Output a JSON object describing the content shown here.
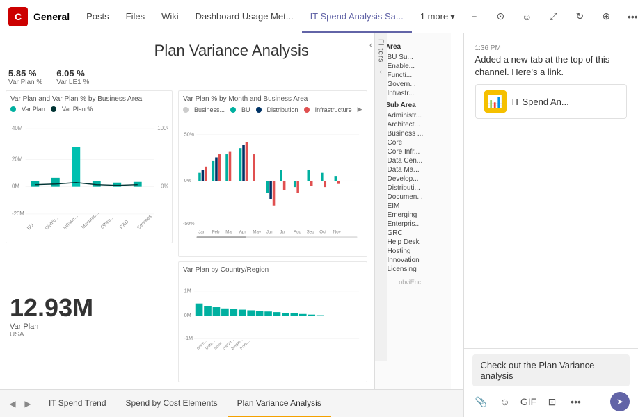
{
  "topnav": {
    "app_icon": "C",
    "channel": "General",
    "tabs": [
      {
        "label": "Posts",
        "active": false
      },
      {
        "label": "Files",
        "active": false
      },
      {
        "label": "Wiki",
        "active": false
      },
      {
        "label": "Dashboard Usage Met...",
        "active": false
      },
      {
        "label": "IT Spend Analysis Sa...",
        "active": true
      },
      {
        "label": "1 more",
        "active": false
      }
    ],
    "add_label": "+",
    "meet_label": "Meet"
  },
  "report": {
    "title": "Plan Variance Analysis",
    "stats": [
      {
        "value": "5.85 %",
        "label": "Var Plan %"
      },
      {
        "value": "6.05 %",
        "label": "Var LE1 %"
      }
    ],
    "line_chart_label": "Var Plan and Var Plan % by Business Area",
    "legend": [
      {
        "label": "Var Plan",
        "color": "#00b0a0"
      },
      {
        "label": "Var Plan %",
        "color": "#003333"
      }
    ],
    "bar_chart_label": "Var Plan % by Month and Business Area",
    "bar_legend": [
      {
        "label": "Business...",
        "color": "#ccc"
      },
      {
        "label": "BU",
        "color": "#00b0a0"
      },
      {
        "label": "Distribution",
        "color": "#003366"
      },
      {
        "label": "Infrastructure",
        "color": "#e05050"
      }
    ],
    "country_chart_label": "Var Plan by Country/Region",
    "big_number": "12.93M",
    "big_label": "Var Plan",
    "big_sublabel": "USA",
    "filters_label": "Filters",
    "it_area_title": "IT Area",
    "it_area_items": [
      "BU Su...",
      "Enable...",
      "Functi...",
      "Govern...",
      "Infrastr..."
    ],
    "it_sub_area_title": "IT Sub Area",
    "it_sub_items": [
      "Administr...",
      "Architect...",
      "Business ...",
      "Core",
      "Core Infr...",
      "Data Cen...",
      "Data Ma...",
      "Develop...",
      "Distributi...",
      "Documen...",
      "EIM",
      "Emerging",
      "Enterpris...",
      "GRC",
      "Help Desk",
      "Hosting",
      "Innovation",
      "Licensing"
    ]
  },
  "tabs": [
    {
      "label": "IT Spend Trend",
      "active": false
    },
    {
      "label": "Spend by Cost Elements",
      "active": false
    },
    {
      "label": "Plan Variance Analysis",
      "active": true
    }
  ],
  "chat": {
    "time": "1:36 PM",
    "message1": "Added a new tab at the top of this channel. Here's a link.",
    "card_title": "IT Spend An...",
    "bubble_text": "Check out the Plan Variance analysis",
    "toolbar_icons": [
      "attach",
      "emoji",
      "gif",
      "sticker",
      "more"
    ],
    "send": "➤"
  }
}
